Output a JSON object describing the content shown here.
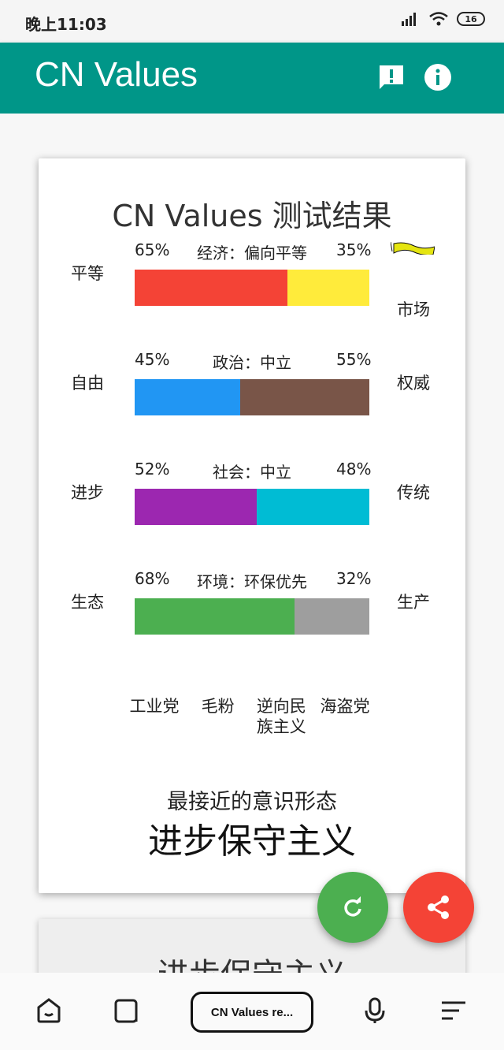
{
  "status_bar": {
    "time": "晚上11:03",
    "battery": "16"
  },
  "app_bar": {
    "title": "CN Values"
  },
  "result_card": {
    "title": "CN Values 测试结果",
    "axes": [
      {
        "left": "平等",
        "right": "市场",
        "left_pct": "65%",
        "right_pct": "35%",
        "label": "经济：偏向平等",
        "left_value": 65,
        "left_color": "#f44336",
        "right_color": "#ffeb3b"
      },
      {
        "left": "自由",
        "right": "权威",
        "left_pct": "45%",
        "right_pct": "55%",
        "label": "政治：中立",
        "left_value": 45,
        "left_color": "#2196f3",
        "right_color": "#795548"
      },
      {
        "left": "进步",
        "right": "传统",
        "left_pct": "52%",
        "right_pct": "48%",
        "label": "社会：中立",
        "left_value": 52,
        "left_color": "#9c27b0",
        "right_color": "#00bcd4"
      },
      {
        "left": "生态",
        "right": "生产",
        "left_pct": "68%",
        "right_pct": "32%",
        "label": "环境：环保优先",
        "left_value": 68,
        "left_color": "#4caf50",
        "right_color": "#9e9e9e"
      }
    ],
    "ideologies": [
      "工业党",
      "毛粉",
      "逆向民族主义",
      "海盗党"
    ],
    "closest_label": "最接近的意识形态",
    "closest_value": "进步保守主义"
  },
  "second_card": {
    "title": "进步保守主义"
  },
  "bottom_nav": {
    "tab_label": "CN Values re..."
  }
}
